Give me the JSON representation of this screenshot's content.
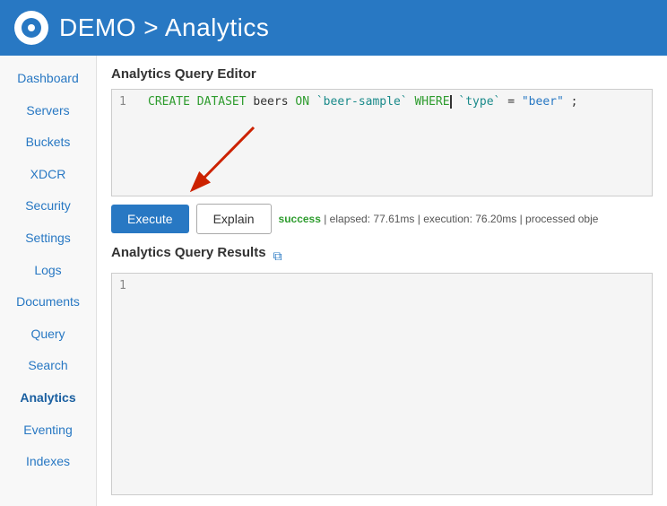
{
  "header": {
    "title": "DEMO > Analytics",
    "logo_alt": "Couchbase logo"
  },
  "sidebar": {
    "items": [
      {
        "label": "Dashboard",
        "active": false
      },
      {
        "label": "Servers",
        "active": false
      },
      {
        "label": "Buckets",
        "active": false
      },
      {
        "label": "XDCR",
        "active": false
      },
      {
        "label": "Security",
        "active": false
      },
      {
        "label": "Settings",
        "active": false
      },
      {
        "label": "Logs",
        "active": false
      },
      {
        "label": "Documents",
        "active": false
      },
      {
        "label": "Query",
        "active": false
      },
      {
        "label": "Search",
        "active": false
      },
      {
        "label": "Analytics",
        "active": true
      },
      {
        "label": "Eventing",
        "active": false
      },
      {
        "label": "Indexes",
        "active": false
      }
    ]
  },
  "editor": {
    "title": "Analytics Query Editor",
    "line_number": "1",
    "code": "CREATE DATASET beers ON `beer-sample` WHERE `type` = \"beer\";"
  },
  "toolbar": {
    "execute_label": "Execute",
    "explain_label": "Explain",
    "status_success": "success",
    "status_detail": "| elapsed: 77.61ms | execution: 76.20ms | processed obje"
  },
  "results": {
    "title": "Analytics Query Results",
    "line_number": "1",
    "copy_icon": "⧉"
  }
}
